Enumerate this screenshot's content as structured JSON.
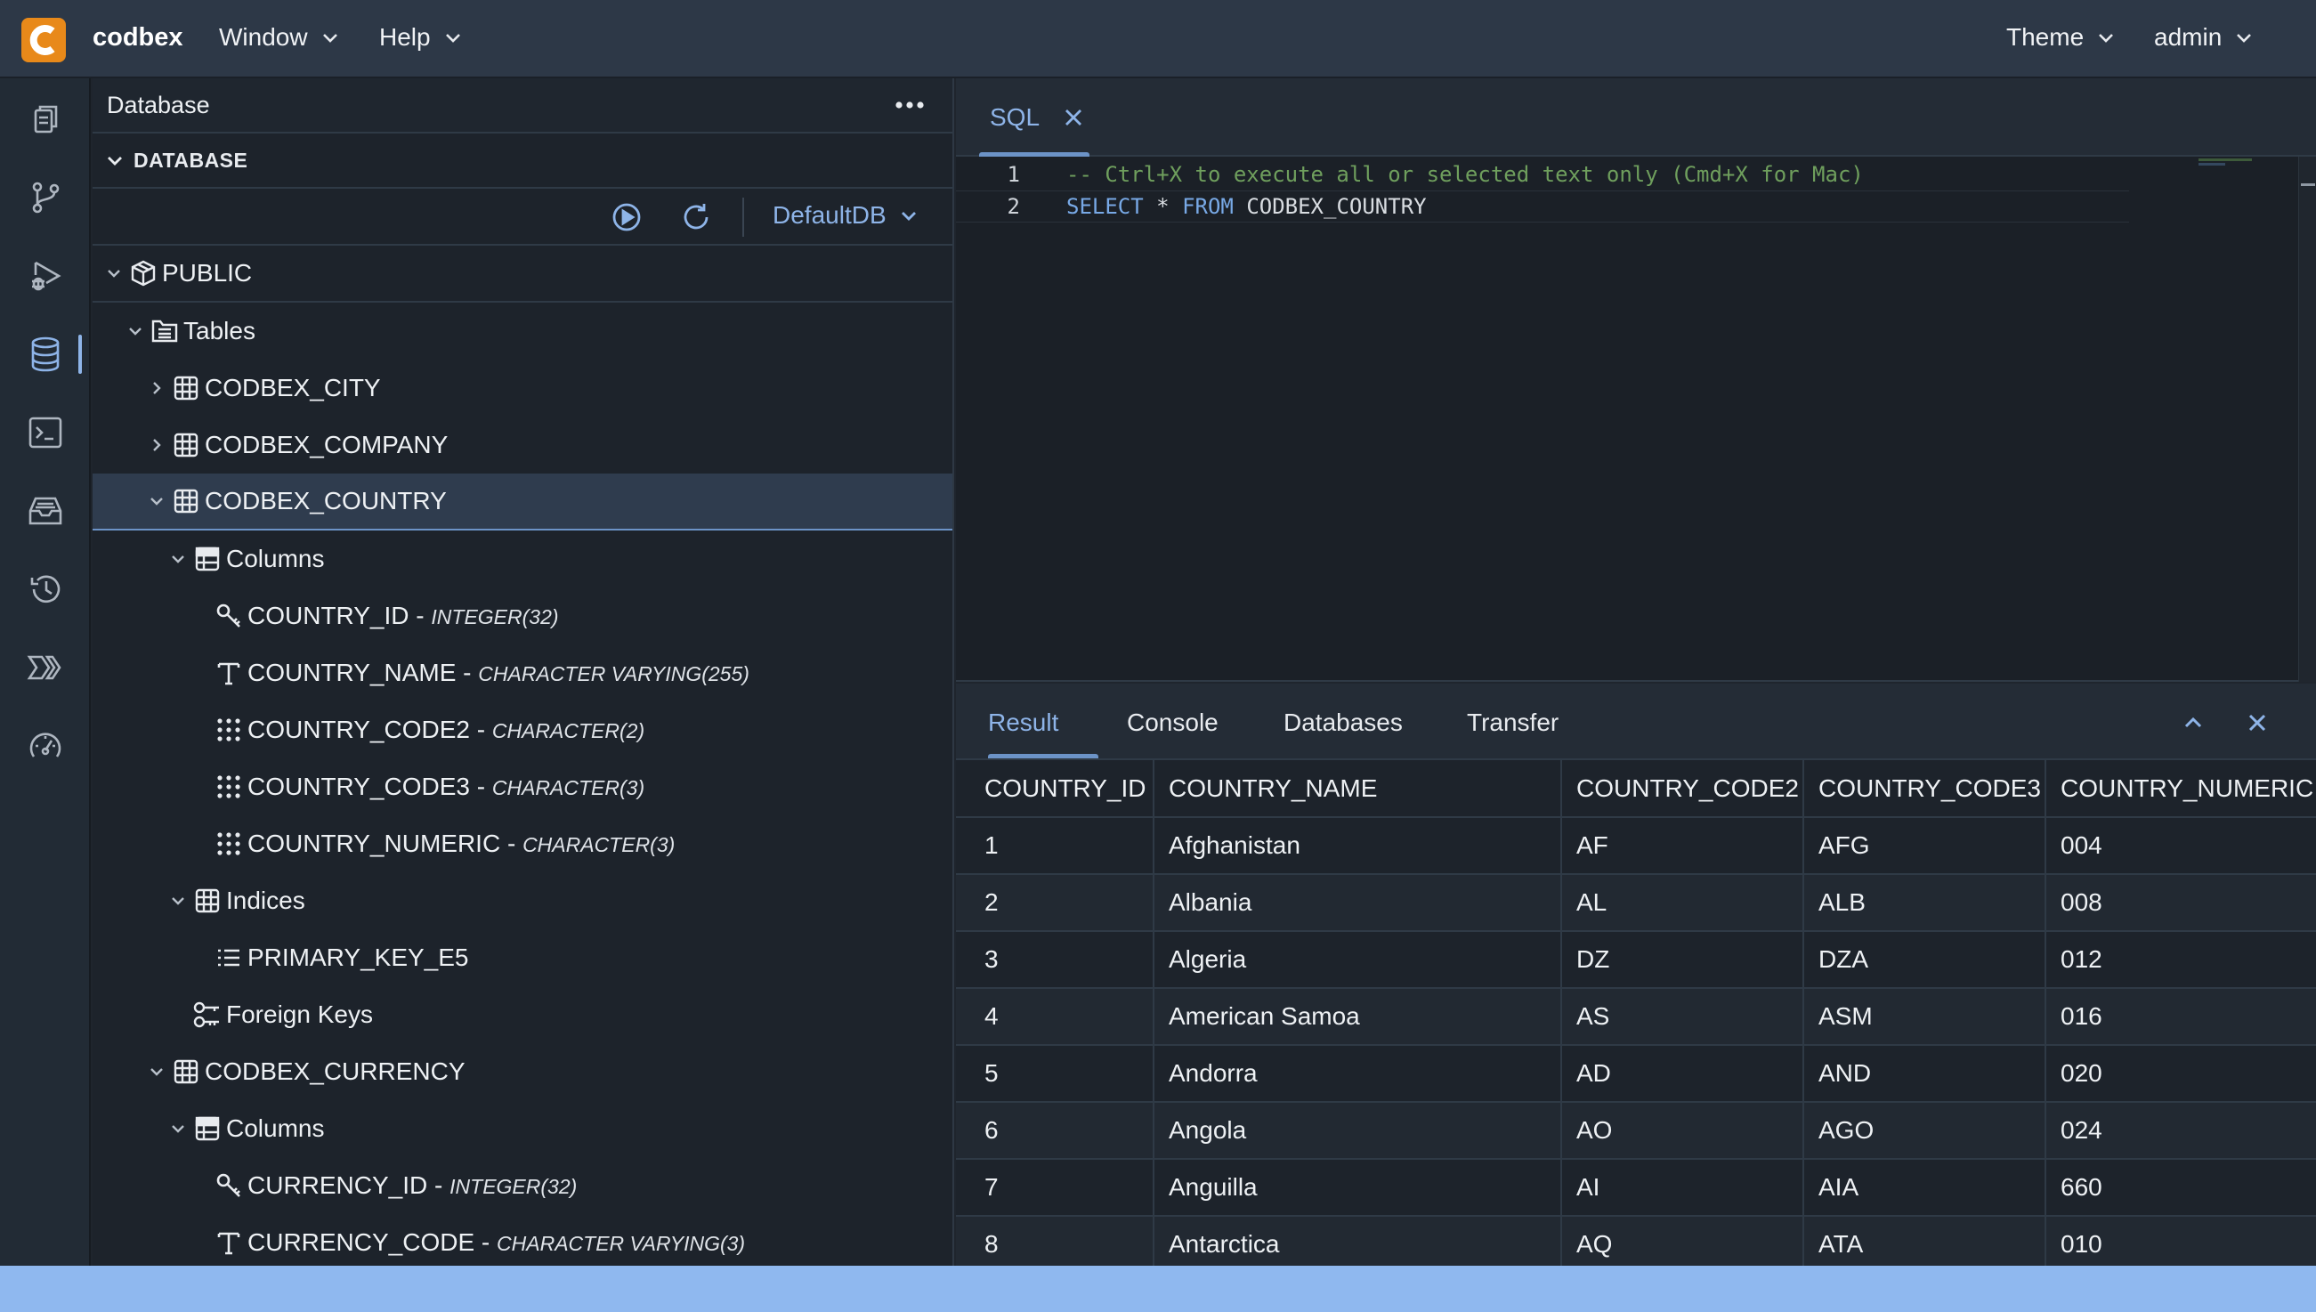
{
  "app": {
    "brand": "codbex",
    "menus": [
      "Window",
      "Help"
    ],
    "right_menus": [
      "Theme",
      "admin"
    ],
    "accent_color": "#e8891a",
    "link_color": "#8eb4e8"
  },
  "rail": {
    "icons": [
      "documents-icon",
      "git-branch-icon",
      "debug-icon",
      "database-icon",
      "terminal-icon",
      "inbox-icon",
      "history-icon",
      "workflow-icon",
      "gauge-icon"
    ],
    "active": "database-icon"
  },
  "database": {
    "title": "Database",
    "section": "DATABASE",
    "selected_db": "DefaultDB",
    "tree": {
      "schema": "PUBLIC",
      "tables_label": "Tables",
      "city": "CODBEX_CITY",
      "company": "CODBEX_COMPANY",
      "country": "CODBEX_COUNTRY",
      "columns_label": "Columns",
      "country_columns": [
        {
          "name": "COUNTRY_ID",
          "type": "INTEGER(32)"
        },
        {
          "name": "COUNTRY_NAME",
          "type": "CHARACTER VARYING(255)"
        },
        {
          "name": "COUNTRY_CODE2",
          "type": "CHARACTER(2)"
        },
        {
          "name": "COUNTRY_CODE3",
          "type": "CHARACTER(3)"
        },
        {
          "name": "COUNTRY_NUMERIC",
          "type": "CHARACTER(3)"
        }
      ],
      "indices_label": "Indices",
      "primary_key": "PRIMARY_KEY_E5",
      "foreign_keys_label": "Foreign Keys",
      "currency": "CODBEX_CURRENCY",
      "currency_columns_label": "Columns",
      "currency_columns": [
        {
          "name": "CURRENCY_ID",
          "type": "INTEGER(32)"
        },
        {
          "name": "CURRENCY_CODE",
          "type": "CHARACTER VARYING(3)"
        }
      ],
      "separator": " - "
    }
  },
  "editor": {
    "tab_label": "SQL",
    "lines": {
      "n1": "1",
      "n2": "2",
      "comment": "-- Ctrl+X to execute all or selected text only (Cmd+X for Mac)",
      "kw_select": "SELECT",
      "star": "*",
      "kw_from": "FROM",
      "table": "CODBEX_COUNTRY"
    }
  },
  "results": {
    "tabs": [
      "Result",
      "Console",
      "Databases",
      "Transfer"
    ],
    "active_tab": "Result",
    "columns": [
      "COUNTRY_ID",
      "COUNTRY_NAME",
      "COUNTRY_CODE2",
      "COUNTRY_CODE3",
      "COUNTRY_NUMERIC"
    ],
    "rows": [
      [
        "1",
        "Afghanistan",
        "AF",
        "AFG",
        "004"
      ],
      [
        "2",
        "Albania",
        "AL",
        "ALB",
        "008"
      ],
      [
        "3",
        "Algeria",
        "DZ",
        "DZA",
        "012"
      ],
      [
        "4",
        "American Samoa",
        "AS",
        "ASM",
        "016"
      ],
      [
        "5",
        "Andorra",
        "AD",
        "AND",
        "020"
      ],
      [
        "6",
        "Angola",
        "AO",
        "AGO",
        "024"
      ],
      [
        "7",
        "Anguilla",
        "AI",
        "AIA",
        "660"
      ],
      [
        "8",
        "Antarctica",
        "AQ",
        "ATA",
        "010"
      ]
    ]
  }
}
